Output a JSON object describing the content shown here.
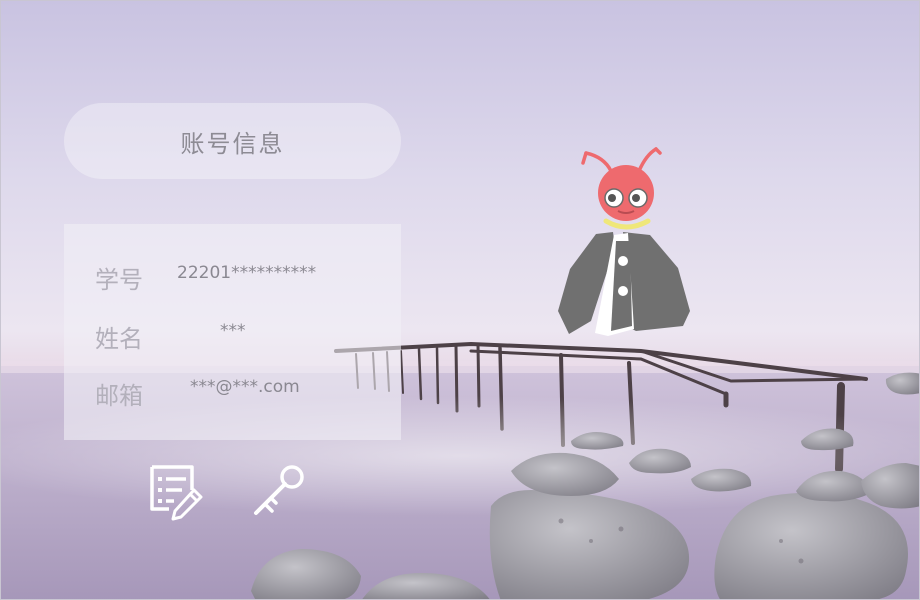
{
  "panel": {
    "title": "账号信息",
    "rows": [
      {
        "label": "学号",
        "value": "22201**********"
      },
      {
        "label": "姓名",
        "value": "***"
      },
      {
        "label": "邮箱",
        "value": "***@***.com"
      }
    ]
  },
  "actions": [
    {
      "icon": "edit-document-icon"
    },
    {
      "icon": "key-icon"
    }
  ],
  "mascot": {
    "icon": "ant-mascot-icon"
  },
  "colors": {
    "mascot_head": "#ee6a6e",
    "mascot_collar": "#efe77a",
    "mascot_body": "#707070",
    "action_icon": "#ffffff"
  }
}
